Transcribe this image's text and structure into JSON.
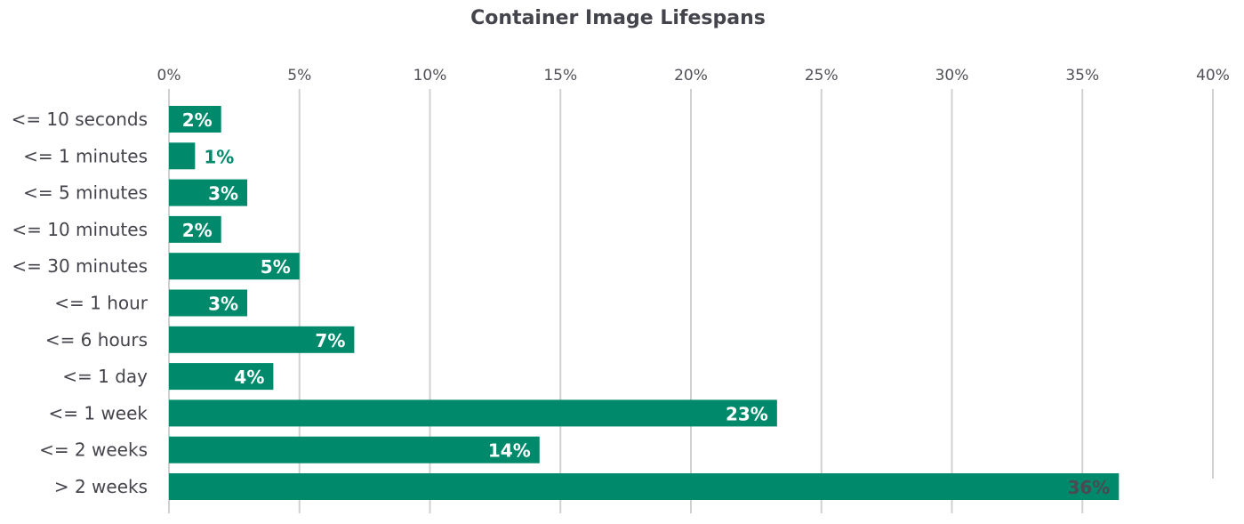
{
  "chart_data": {
    "type": "bar",
    "orientation": "horizontal",
    "title": "Container Image Lifespans",
    "xlabel": "",
    "ylabel": "",
    "xlim": [
      0,
      40
    ],
    "x_ticks": [
      "0%",
      "5%",
      "10%",
      "15%",
      "20%",
      "25%",
      "30%",
      "35%",
      "40%"
    ],
    "x_tick_values": [
      0,
      5,
      10,
      15,
      20,
      25,
      30,
      35,
      40
    ],
    "x_axis_position": "top",
    "grid": true,
    "legend": "none",
    "categories": [
      "<= 10 seconds",
      "<= 1 minutes",
      "<= 5 minutes",
      "<= 10 minutes",
      "<= 30 minutes",
      "<= 1 hour",
      "<= 6 hours",
      "<= 1 day",
      "<= 1 week",
      "<= 2 weeks",
      "> 2 weeks"
    ],
    "values": [
      2,
      1,
      3,
      2,
      5,
      3,
      7.1,
      4,
      23.3,
      14.2,
      36.4
    ],
    "data_labels": [
      "2%",
      "1%",
      "3%",
      "2%",
      "5%",
      "3%",
      "7%",
      "4%",
      "23%",
      "14%",
      "36%"
    ],
    "colors": {
      "bar": "#008a6b",
      "label_inside": "#ffffff",
      "label_outside": "#008a6b",
      "label_last": "#4a4a52",
      "grid": "#d0d0d0"
    }
  }
}
